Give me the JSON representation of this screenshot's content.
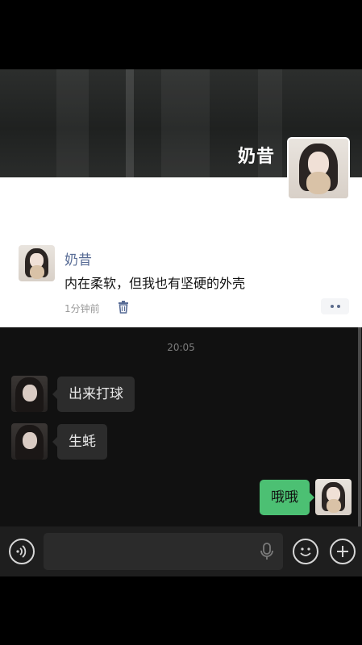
{
  "moments": {
    "cover_name": "奶昔",
    "post": {
      "author": "奶昔",
      "text": "内在柔软，但我也有坚硬的外壳",
      "time": "1分钟前"
    }
  },
  "chat": {
    "timestamp": "20:05",
    "messages": [
      {
        "side": "left",
        "text": "出来打球"
      },
      {
        "side": "left",
        "text": "生蚝"
      },
      {
        "side": "right",
        "text": "哦哦"
      }
    ]
  },
  "input_bar": {
    "placeholder": "",
    "icons": [
      "voice-icon",
      "mic-icon",
      "emoji-icon",
      "plus-icon"
    ]
  },
  "colors": {
    "name_link": "#576b95",
    "outgoing_bubble": "#4cc073",
    "incoming_bubble": "#2c2c2c",
    "chat_bg": "#111111"
  }
}
